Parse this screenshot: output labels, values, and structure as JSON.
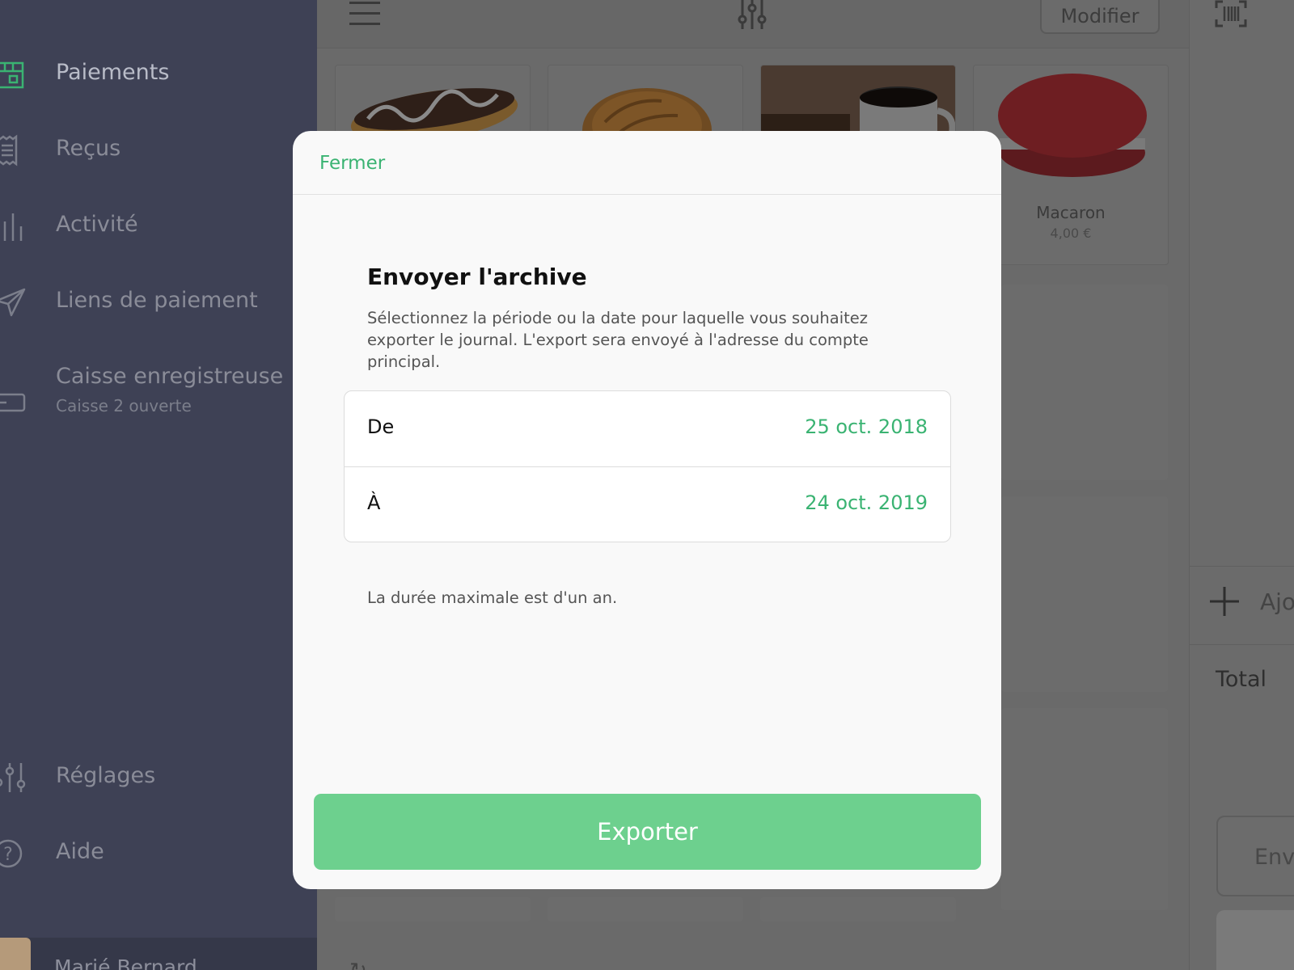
{
  "sidebar": {
    "items": [
      {
        "label": "Paiements",
        "icon": "shop-icon",
        "active": true
      },
      {
        "label": "Reçus",
        "icon": "receipt-icon"
      },
      {
        "label": "Activité",
        "icon": "activity-icon"
      },
      {
        "label": "Liens de paiement",
        "icon": "send-icon"
      },
      {
        "label": "Caisse enregistreuse",
        "sublabel": "Caisse 2 ouverte",
        "icon": "cash-register-icon"
      }
    ],
    "bottom_items": [
      {
        "label": "Réglages",
        "icon": "settings-sliders-icon"
      },
      {
        "label": "Aide",
        "icon": "help-icon"
      }
    ],
    "user": {
      "name": "Marié Bernard"
    }
  },
  "header": {
    "modify_label": "Modifier"
  },
  "products": [
    {
      "name": "",
      "price": "",
      "image": "eclair"
    },
    {
      "name": "",
      "price": "",
      "image": "croissant"
    },
    {
      "name": "",
      "price": "",
      "image": "coffee"
    },
    {
      "name": "Macaron",
      "price": "4,00 €",
      "image": "macaron"
    }
  ],
  "cart": {
    "add_label": "Ajo",
    "total_label": "Total",
    "send_label": "Env"
  },
  "modal": {
    "close_label": "Fermer",
    "title": "Envoyer l'archive",
    "description": "Sélectionnez la période ou la date pour laquelle vous souhaitez exporter le journal. L'export sera envoyé à l'adresse du compte principal.",
    "from_label": "De",
    "from_value": "25 oct. 2018",
    "to_label": "À",
    "to_value": "24 oct. 2019",
    "note": "La durée maximale est d'un an.",
    "export_label": "Exporter"
  },
  "colors": {
    "accent": "#3ab372",
    "export_button": "#6dd08e",
    "sidebar_bg": "#3e4155"
  }
}
